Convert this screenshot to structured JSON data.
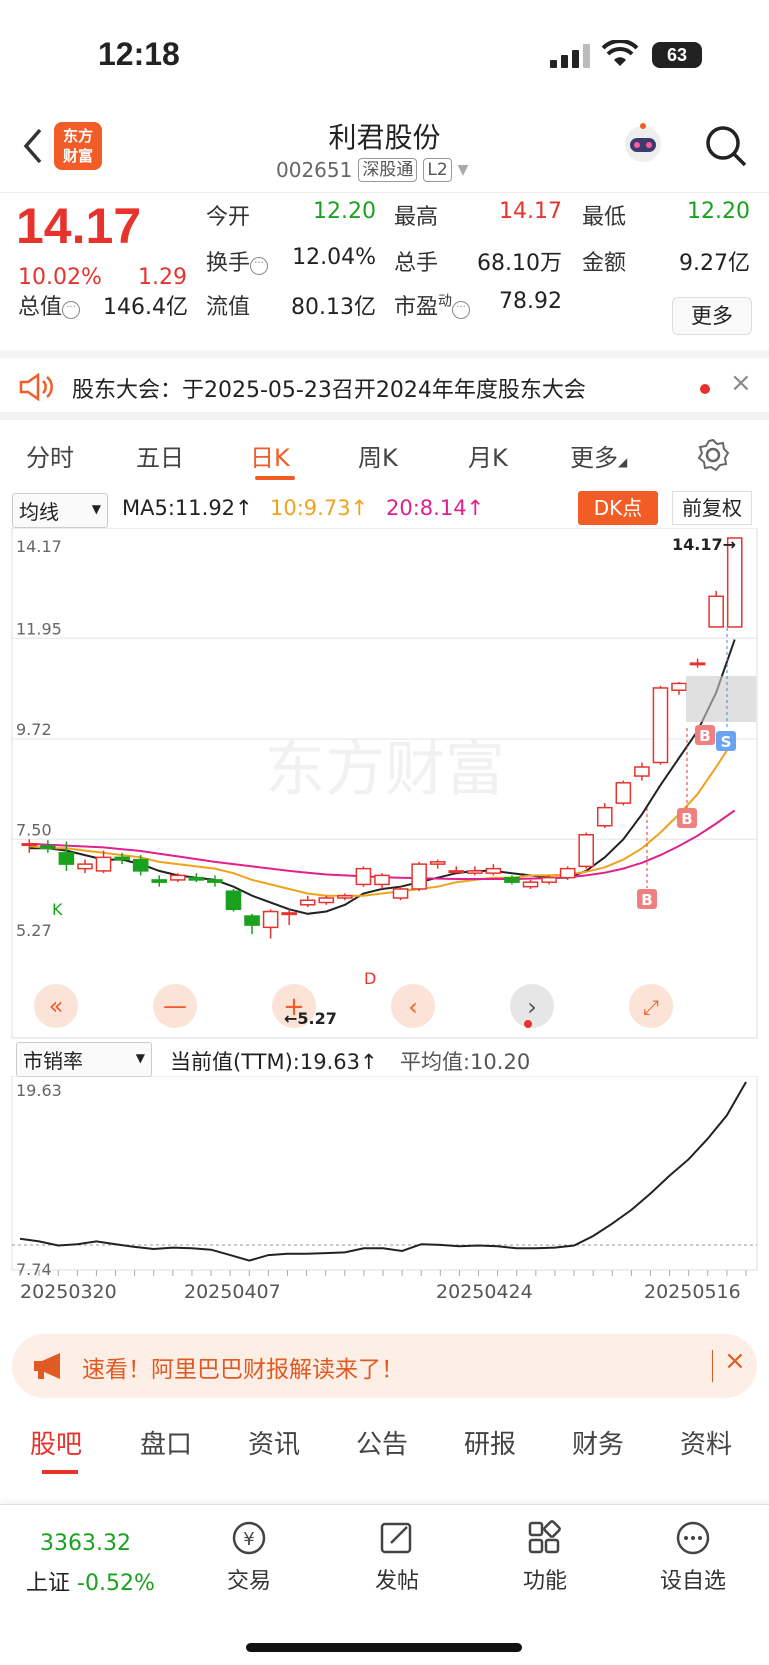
{
  "status": {
    "time": "12:18",
    "battery": "63"
  },
  "header": {
    "title": "利君股份",
    "code": "002651",
    "market_tag": "深股通",
    "level_tag": "L2",
    "logo_text_1": "东方",
    "logo_text_2": "财富"
  },
  "quote": {
    "price": "14.17",
    "change_pct": "10.02%",
    "change_abs": "1.29",
    "open_label": "今开",
    "open": "12.20",
    "high_label": "最高",
    "high": "14.17",
    "low_label": "最低",
    "low": "12.20",
    "turnover_label": "换手",
    "turnover": "12.04%",
    "volume_label": "总手",
    "volume": "68.10万",
    "amount_label": "金额",
    "amount": "9.27亿",
    "mktcap_label": "总值",
    "mktcap": "146.4亿",
    "float_label": "流值",
    "float": "80.13亿",
    "pe_label": "市盈",
    "pe_sup": "动",
    "pe": "78.92",
    "more": "更多"
  },
  "notice": {
    "text": "股东大会：于2025-05-23召开2024年年度股东大会"
  },
  "period_tabs": [
    "分时",
    "五日",
    "日K",
    "周K",
    "月K",
    "更多"
  ],
  "ma_bar": {
    "indicator": "均线",
    "ma5": "MA5:11.92↑",
    "ma10": "10:9.73↑",
    "ma20": "20:8.14↑",
    "dk": "DK点",
    "adjust": "前复权"
  },
  "colors": {
    "up": "#e8332d",
    "down": "#1aa11e",
    "ma5": "#222222",
    "ma10": "#f0a21c",
    "ma20": "#e0208c",
    "accent": "#f25c26"
  },
  "chart_data": [
    {
      "type": "candlestick",
      "y_ticks": [
        "14.17",
        "11.95",
        "9.72",
        "7.50",
        "5.27"
      ],
      "ylim": [
        5.27,
        14.17
      ],
      "max_label": "14.17→",
      "min_label": "←5.27",
      "watermark": "东方财富",
      "candles": [
        [
          7.38,
          7.4,
          7.2,
          7.5
        ],
        [
          7.35,
          7.3,
          7.2,
          7.48
        ],
        [
          7.2,
          6.95,
          6.8,
          7.45
        ],
        [
          6.85,
          6.95,
          6.75,
          7.05
        ],
        [
          6.8,
          7.1,
          6.75,
          7.25
        ],
        [
          7.1,
          7.05,
          6.95,
          7.2
        ],
        [
          7.05,
          6.8,
          6.7,
          7.15
        ],
        [
          6.6,
          6.55,
          6.45,
          6.7
        ],
        [
          6.6,
          6.7,
          6.55,
          6.75
        ],
        [
          6.65,
          6.6,
          6.55,
          6.75
        ],
        [
          6.6,
          6.55,
          6.45,
          6.7
        ],
        [
          6.35,
          5.95,
          5.9,
          6.4
        ],
        [
          5.8,
          5.6,
          5.4,
          5.85
        ],
        [
          5.55,
          5.9,
          5.3,
          5.95
        ],
        [
          5.85,
          5.87,
          5.6,
          5.95
        ],
        [
          6.05,
          6.15,
          6.0,
          6.25
        ],
        [
          6.1,
          6.2,
          6.05,
          6.25
        ],
        [
          6.2,
          6.25,
          6.15,
          6.3
        ],
        [
          6.5,
          6.85,
          6.45,
          6.9
        ],
        [
          6.5,
          6.7,
          6.4,
          6.75
        ],
        [
          6.2,
          6.4,
          6.15,
          6.45
        ],
        [
          6.4,
          6.95,
          6.35,
          7.0
        ],
        [
          6.95,
          7.0,
          6.85,
          7.05
        ],
        [
          6.8,
          6.8,
          6.75,
          6.9
        ],
        [
          6.75,
          6.8,
          6.7,
          6.9
        ],
        [
          6.75,
          6.85,
          6.7,
          6.95
        ],
        [
          6.65,
          6.55,
          6.5,
          6.7
        ],
        [
          6.45,
          6.55,
          6.4,
          6.6
        ],
        [
          6.55,
          6.65,
          6.5,
          6.7
        ],
        [
          6.65,
          6.85,
          6.6,
          6.9
        ],
        [
          6.9,
          7.6,
          6.85,
          7.65
        ],
        [
          7.8,
          8.2,
          7.75,
          8.3
        ],
        [
          8.3,
          8.75,
          8.25,
          8.8
        ],
        [
          8.9,
          9.1,
          8.8,
          9.2
        ],
        [
          9.2,
          10.85,
          9.15,
          10.9
        ],
        [
          10.8,
          10.95,
          10.7,
          10.98
        ],
        [
          11.4,
          11.4,
          11.3,
          11.5
        ],
        [
          12.2,
          12.88,
          12.2,
          13.0
        ],
        [
          12.2,
          14.17,
          12.2,
          14.17
        ]
      ],
      "ma5": [
        7.3,
        7.3,
        7.25,
        7.15,
        7.05,
        7.05,
        6.95,
        6.8,
        6.7,
        6.65,
        6.6,
        6.45,
        6.25,
        6.1,
        5.95,
        5.85,
        5.9,
        6.05,
        6.3,
        6.4,
        6.45,
        6.55,
        6.65,
        6.75,
        6.8,
        6.8,
        6.75,
        6.7,
        6.65,
        6.65,
        6.8,
        7.1,
        7.5,
        8.05,
        8.7,
        9.3,
        9.9,
        10.75,
        11.92
      ],
      "ma10": [
        7.35,
        7.3,
        7.3,
        7.25,
        7.2,
        7.15,
        7.1,
        7.0,
        6.95,
        6.9,
        6.85,
        6.75,
        6.6,
        6.5,
        6.4,
        6.3,
        6.25,
        6.25,
        6.25,
        6.3,
        6.35,
        6.4,
        6.45,
        6.55,
        6.6,
        6.65,
        6.65,
        6.7,
        6.7,
        6.72,
        6.78,
        6.88,
        7.05,
        7.3,
        7.65,
        8.05,
        8.5,
        9.1,
        9.73
      ],
      "ma20": [
        7.4,
        7.38,
        7.36,
        7.34,
        7.32,
        7.28,
        7.24,
        7.18,
        7.12,
        7.06,
        7.0,
        6.95,
        6.9,
        6.85,
        6.8,
        6.76,
        6.72,
        6.7,
        6.68,
        6.66,
        6.65,
        6.64,
        6.63,
        6.62,
        6.62,
        6.62,
        6.62,
        6.63,
        6.64,
        6.66,
        6.7,
        6.76,
        6.85,
        6.98,
        7.15,
        7.35,
        7.58,
        7.85,
        8.14
      ]
    },
    {
      "type": "line",
      "indicator": "市销率",
      "current": "当前值(TTM):19.63↑",
      "average": "平均值:10.20",
      "y_ticks": [
        "19.63",
        "7.74"
      ],
      "ylim": [
        6.5,
        19.63
      ],
      "x_labels": [
        "20250320",
        "20250407",
        "20250424",
        "20250516"
      ],
      "values": [
        8.2,
        8.0,
        7.7,
        7.8,
        8.0,
        7.8,
        7.6,
        7.45,
        7.55,
        7.5,
        7.4,
        7.0,
        6.6,
        7.0,
        7.1,
        7.1,
        7.15,
        7.2,
        7.5,
        7.5,
        7.3,
        7.8,
        7.75,
        7.65,
        7.7,
        7.65,
        7.5,
        7.5,
        7.55,
        7.7,
        8.4,
        9.3,
        10.3,
        11.5,
        12.8,
        14.0,
        15.5,
        17.2,
        19.63
      ]
    }
  ],
  "banner": {
    "text": "速看！阿里巴巴财报解读来了！"
  },
  "section_tabs": [
    "股吧",
    "盘口",
    "资讯",
    "公告",
    "研报",
    "财务",
    "资料"
  ],
  "bottom": {
    "index_value": "3363.32",
    "index_name": "上证",
    "index_change": "-0.52%",
    "items": [
      "交易",
      "发帖",
      "功能",
      "设自选"
    ]
  }
}
